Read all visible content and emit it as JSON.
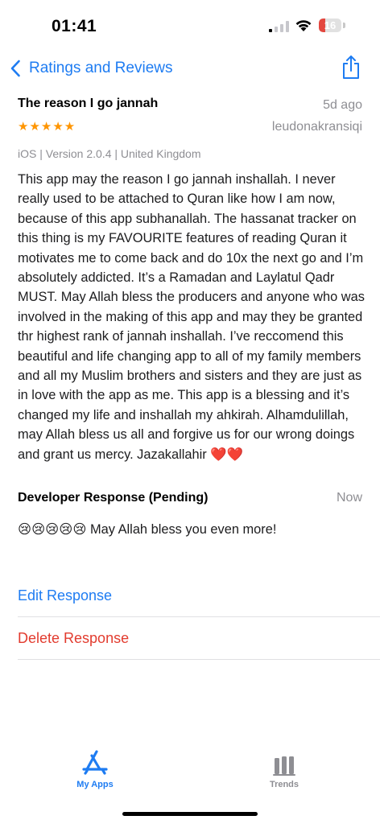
{
  "status_bar": {
    "time": "01:41",
    "battery_level": "16",
    "battery_fraction": 0.16,
    "battery_color": "#e3473f"
  },
  "nav": {
    "back_label": "Ratings and Reviews",
    "back_icon": "chevron-left-icon",
    "share_icon": "share-icon",
    "accent_color": "#1e7cf2"
  },
  "review": {
    "title": "The reason I go jannah",
    "date": "5d ago",
    "stars": "★★★★★",
    "rating": 5,
    "author": "leudonakransiqi",
    "meta": "iOS | Version 2.0.4 | United Kingdom",
    "body": "This app may the reason I go jannah inshallah. I never really used to be attached to Quran like how I am now, because of this app subhanallah. The hassanat tracker on this thing is my FAVOURITE features of reading Quran it motivates me to come back and do 10x the next go and I’m absolutely addicted. It’s a Ramadan and Laylatul Qadr MUST. May Allah bless the producers and anyone who was involved in the making of this app and may they be granted thr highest rank of jannah inshallah. I’ve reccomend this beautiful and life changing app to all of my family members and all my Muslim brothers and sisters and they are just as in love with the app as me. This app is a blessing and it’s changed my life and inshallah my ahkirah. Alhamdulillah, may Allah bless us all and forgive us for our wrong doings and grant us mercy. Jazakallahir ❤️❤️"
  },
  "developer_response": {
    "title": "Developer Response (Pending)",
    "time": "Now",
    "body": "😢😢😢😢😢 May Allah bless you even more!"
  },
  "actions": {
    "edit_label": "Edit Response",
    "delete_label": "Delete Response",
    "delete_color": "#e23c2f"
  },
  "tab_bar": {
    "my_apps_label": "My Apps",
    "my_apps_icon": "app-store-icon",
    "trends_label": "Trends",
    "trends_icon": "bar-chart-icon"
  }
}
